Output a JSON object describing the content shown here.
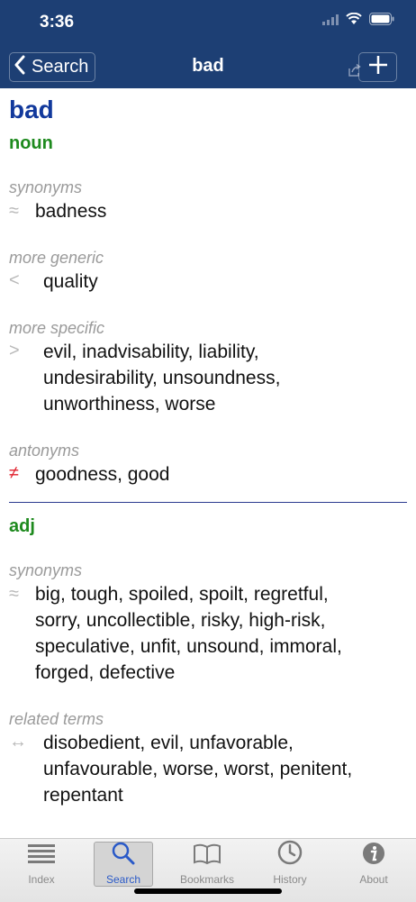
{
  "status": {
    "time": "3:36"
  },
  "nav": {
    "back_label": "Search",
    "title": "bad"
  },
  "entry": {
    "headword": "bad",
    "sections": [
      {
        "pos": "noun",
        "groups": [
          {
            "label": "synonyms",
            "symbol": "≈",
            "text": "badness"
          },
          {
            "label": "more generic",
            "symbol": "<",
            "text": "quality"
          },
          {
            "label": "more specific",
            "symbol": ">",
            "text": "evil, inadvisability, liability, undesirability, unsoundness, unworthiness, worse"
          },
          {
            "label": "antonyms",
            "symbol": "≠",
            "text": "goodness, good"
          }
        ]
      },
      {
        "pos": "adj",
        "groups": [
          {
            "label": "synonyms",
            "symbol": "≈",
            "text": "big, tough, spoiled, spoilt, regretful, sorry, uncollectible, risky, high-risk, speculative, unfit, unsound, immoral, forged, defective"
          },
          {
            "label": "related terms",
            "symbol": "↔",
            "text": "disobedient, evil, unfavorable, unfavourable, worse, worst, penitent, repentant"
          }
        ]
      }
    ]
  },
  "tabs": [
    {
      "label": "Index",
      "icon": "list-icon"
    },
    {
      "label": "Search",
      "icon": "magnifier-icon",
      "selected": true
    },
    {
      "label": "Bookmarks",
      "icon": "book-icon"
    },
    {
      "label": "History",
      "icon": "clock-icon"
    },
    {
      "label": "About",
      "icon": "info-icon"
    }
  ],
  "colors": {
    "header": "#1d3f74",
    "headword": "#12399c",
    "pos": "#1e8a1e",
    "label": "#9a9a9a",
    "antonym_symbol": "#e0202c",
    "tab_selected": "#2a5ac8"
  }
}
